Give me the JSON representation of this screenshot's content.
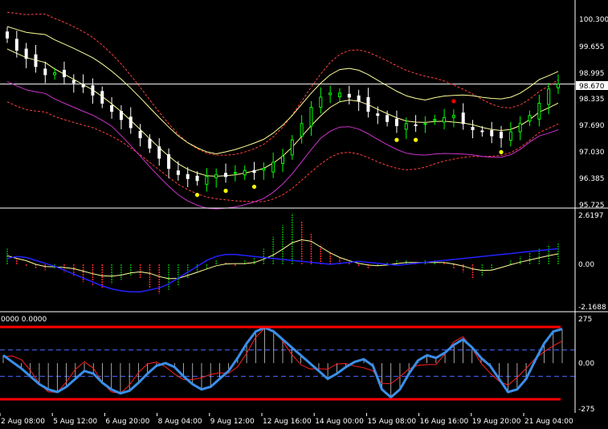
{
  "colors": {
    "background": "#000000",
    "foreground": "#ffffff",
    "bull_candle": "#00ff00",
    "bear_candle": "#ffffff",
    "band_outer": "#ff4040",
    "band_middle": "#ffff99",
    "band_lower_solid": "#cc33cc",
    "histogram_up": "#00aa00",
    "histogram_down": "#ff2a2a",
    "signal_blue": "#2222ff",
    "cci_blue": "#3a8fe8",
    "cci_red": "#ff2020",
    "level_red": "#ff0000",
    "dash_blue": "#4a6aff",
    "marker_red": "#ff0000",
    "marker_yellow": "#ffff00"
  },
  "chart_data": [
    {
      "type": "candlestick",
      "panel": "price",
      "y_ticks": [
        "100.300",
        "99.655",
        "98.995",
        "98.335",
        "97.690",
        "97.030",
        "96.385",
        "95.725"
      ],
      "ylim": [
        95.725,
        100.3
      ],
      "current_price": "98.670",
      "current_value": 98.67,
      "closes": [
        99.8,
        99.5,
        99.3,
        99.1,
        98.9,
        98.95,
        98.85,
        98.7,
        98.6,
        98.4,
        98.2,
        98.0,
        97.8,
        97.6,
        97.35,
        97.1,
        96.85,
        96.6,
        96.45,
        96.35,
        96.3,
        96.4,
        96.45,
        96.4,
        96.5,
        96.55,
        96.5,
        96.6,
        96.75,
        96.9,
        97.3,
        97.7,
        98.1,
        98.35,
        98.45,
        98.45,
        98.35,
        98.25,
        98.0,
        97.9,
        97.75,
        97.65,
        97.7,
        97.65,
        97.7,
        97.8,
        97.85,
        97.9,
        97.7,
        97.55,
        97.5,
        97.4,
        97.35,
        97.5,
        97.7,
        97.9,
        98.2,
        98.55,
        98.67
      ]
    },
    {
      "type": "histogram",
      "panel": "oscillator",
      "y_ticks": [
        "2.6197",
        "0.00",
        "-2.1688"
      ],
      "ylim": [
        -2.1688,
        2.6197
      ],
      "histogram": [
        0.8,
        0.3,
        -0.1,
        -0.2,
        -0.3,
        -0.2,
        -0.4,
        -0.6,
        -0.9,
        -1.1,
        -1.2,
        -1.0,
        -0.8,
        -0.6,
        -0.7,
        -1.2,
        -1.5,
        -1.3,
        -1.1,
        -0.7,
        -0.4,
        -0.2,
        0.2,
        0.1,
        -0.1,
        0.2,
        0.4,
        0.8,
        1.4,
        2.0,
        2.6,
        2.2,
        1.6,
        1.0,
        0.6,
        0.3,
        0.1,
        -0.1,
        -0.2,
        -0.1,
        0.1,
        0.2,
        0.2,
        0.1,
        0.2,
        0.2,
        0.1,
        -0.2,
        -0.4,
        -0.7,
        -0.6,
        -0.3,
        0.0,
        0.2,
        0.4,
        0.6,
        0.8,
        1.0,
        1.1
      ],
      "signal": [
        0.3,
        0.4,
        0.35,
        0.2,
        0.05,
        -0.1,
        -0.3,
        -0.5,
        -0.7,
        -0.9,
        -1.1,
        -1.25,
        -1.35,
        -1.4,
        -1.4,
        -1.3,
        -1.2,
        -1.0,
        -0.7,
        -0.4,
        -0.1,
        0.2,
        0.4,
        0.5,
        0.5,
        0.45,
        0.4,
        0.35,
        0.3,
        0.25,
        0.2,
        0.15,
        0.1,
        0.05,
        0.0,
        0.05,
        0.1,
        0.15,
        0.1,
        0.05,
        0.0,
        -0.05,
        0.0,
        0.05,
        0.1,
        0.15,
        0.2,
        0.25,
        0.3,
        0.35,
        0.4,
        0.45,
        0.5,
        0.55,
        0.6,
        0.65,
        0.7,
        0.75,
        0.8
      ]
    },
    {
      "type": "line",
      "panel": "cci",
      "header": "0000 0.0000",
      "y_ticks": [
        "275",
        "0.00",
        "-275"
      ],
      "ylim": [
        -275,
        275
      ],
      "upper_level": 275,
      "lower_level": -275,
      "dashed_levels": [
        100,
        -100
      ],
      "cci_main": [
        60,
        10,
        -40,
        -100,
        -160,
        -200,
        -220,
        -180,
        -120,
        -60,
        -80,
        -150,
        -200,
        -230,
        -210,
        -150,
        -80,
        -20,
        0,
        -30,
        -100,
        -160,
        -200,
        -180,
        -120,
        -60,
        40,
        150,
        240,
        270,
        240,
        180,
        120,
        60,
        0,
        -60,
        -120,
        -80,
        -30,
        10,
        30,
        -20,
        -200,
        -260,
        -200,
        -80,
        20,
        60,
        40,
        80,
        140,
        180,
        120,
        40,
        -20,
        -120,
        -220,
        -200,
        -120,
        20,
        150,
        240,
        260
      ]
    }
  ],
  "time_labels": [
    "2 Aug 08:00",
    "5 Aug 12:00",
    "6 Aug 20:00",
    "8 Aug 04:00",
    "9 Aug 12:00",
    "12 Aug 16:00",
    "14 Aug 00:00",
    "15 Aug 08:00",
    "16 Aug 16:00",
    "19 Aug 20:00",
    "21 Aug 04:00"
  ]
}
